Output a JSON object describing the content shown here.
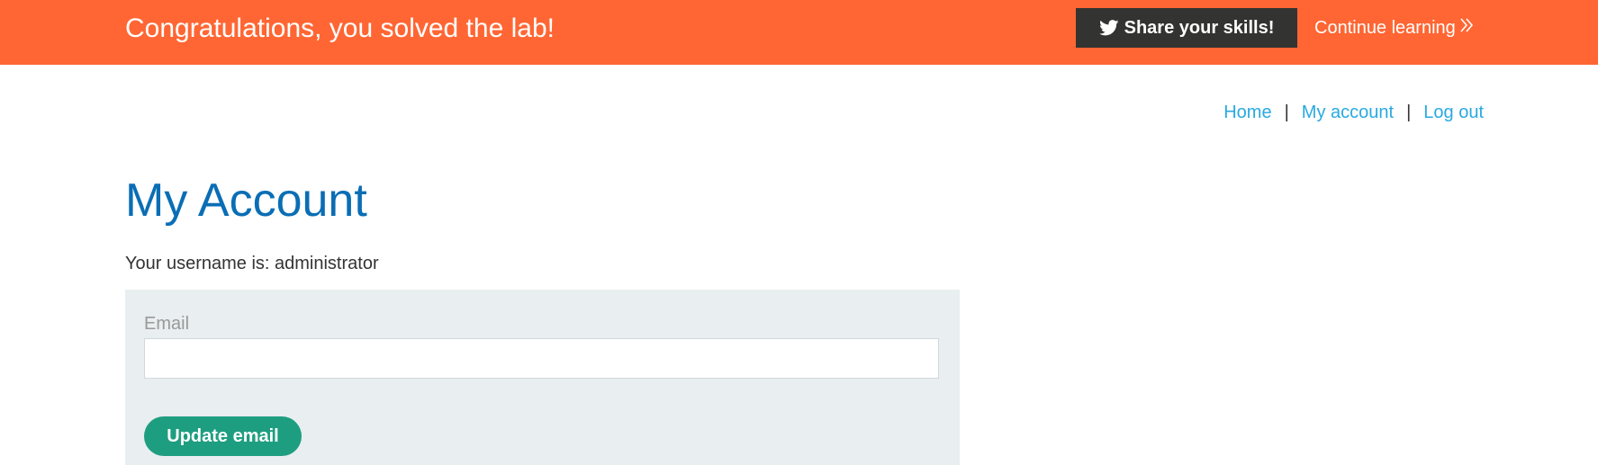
{
  "banner": {
    "message": "Congratulations, you solved the lab!",
    "share_label": "Share your skills!",
    "continue_label": "Continue learning",
    "share_icon": "twitter-icon",
    "continue_icon": "double-chevron-right-icon",
    "background_color": "#ff6633"
  },
  "nav": {
    "items": [
      {
        "label": "Home"
      },
      {
        "label": "My account"
      },
      {
        "label": "Log out"
      }
    ],
    "separator": "|"
  },
  "account": {
    "title": "My Account",
    "username_text": "Your username is: administrator",
    "email_label": "Email",
    "email_value": "",
    "update_label": "Update email"
  },
  "colors": {
    "title": "#0a6eb5",
    "link": "#29a9e0",
    "button": "#1e9e80",
    "panel": "#e9eef0"
  }
}
